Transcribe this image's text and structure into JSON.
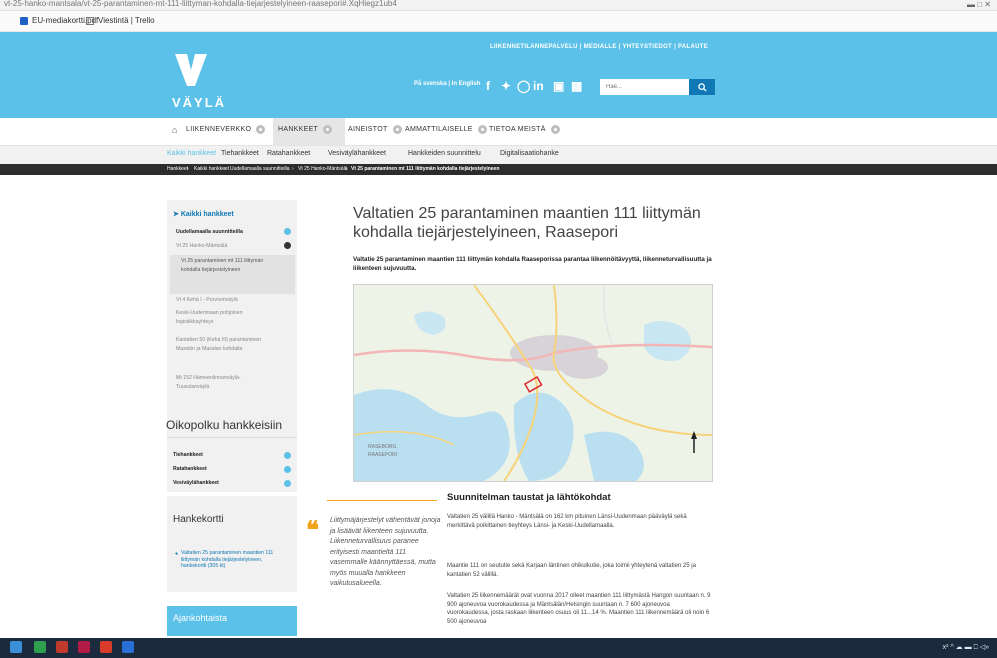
{
  "browser": {
    "url": "vt-25-hanko-mantsala/vt-25-parantaminen-mt-111-liittyman-kohdalla-tiejarjestelyineen-raasepori#.XqHiegz1ub4",
    "bookmarks": [
      {
        "label": "EU-mediakortti.pdf",
        "icon": "pdf-icon"
      },
      {
        "label": "Viestintä | Trello",
        "icon": "trello-icon"
      }
    ]
  },
  "header": {
    "top_links": "LIIKENNETILANNEPALVELU  |  MEDIALLE  |  YHTEYSTIEDOT  |  PALAUTE",
    "logo_text": "VÄYLÄ",
    "lang_sv": "På svenska",
    "lang_en": "In English",
    "search_placeholder": "Hae...",
    "colors": {
      "brand": "#5cc1e8",
      "button": "#0f78b5",
      "accent": "#f2a31a"
    }
  },
  "main_nav": [
    "LIIKENNEVERKKO",
    "HANKKEET",
    "AINEISTOT",
    "AMMATTILAISELLE",
    "TIETOA MEISTÄ"
  ],
  "sub_nav": [
    "Kaikki hankkeet",
    "Tiehankkeet",
    "Ratahankkeet",
    "Vesiväylähankkeet",
    "Hankkeiden suunnittelu",
    "Digitalisaatiohanke"
  ],
  "breadcrumb": [
    "Hankkeet",
    "Kaikki hankkeet",
    "Uudellamaalla suunnitteilla",
    "Vt 25 Hanko-Mäntsälä",
    "Vt 25 parantaminen mt 111 liittymän kohdalla tiejärjestelyineen"
  ],
  "sidebar": {
    "title": "Kaikki hankkeet",
    "section": "Uudellamaalla suunnitteilla",
    "sub": "Vt 25 Hanko-Mäntsälä",
    "selected": "Vt 25 parantaminen mt 111 liittymän kohdalla tiejärjestelyineen",
    "items": [
      "Vt 4 Kehä I - Porvoonväylä",
      "Keski-Uudenmaan pohjoinen logistiikkayhteys",
      "Kantatien 50 (Kehä III) parantaminen Maxxkin ja Masalan kohdalla",
      "Mt 152 Hämeenlinnanväylä-Tuusulanväylä"
    ],
    "shortcut_title": "Oikopolku hankkeisiin",
    "shortcuts": [
      "Tiehankkeet",
      "Ratahankkeet",
      "Vesiväylähankkeet"
    ],
    "card_title": "Hankekortti",
    "card_link": "Valtatien 25 parantaminen maantien 111 liittymän kohdalla tiejärjestelyineen, hankekortti (305 kt)",
    "news_title": "Ajankohtaista"
  },
  "content": {
    "title": "Valtatien 25 parantaminen maantien 111 liittymän kohdalla tiejärjestelyineen, Raasepori",
    "lead": "Valtatie 25 parantaminen maantien 111 liittymän kohdalla Raaseporissa parantaa liikennöitävyyttä, liikenneturvallisuutta ja liikenteen sujuvuutta.",
    "map_labels": [
      "RASEBORG",
      "RAASEPORI"
    ],
    "section_title": "Suunnitelman taustat ja lähtökohdat",
    "quote": "Liittymäjärjestelyt vähentävät jonoja ja lisäävät liikenteen sujuvuutta. Liikenneturvallisuus paranee erityisesti maantieltä 111 vasemmalle käännyttäessä, mutta myös muualla hankkeen vaikutusalueella.",
    "paragraphs": [
      "Valtatien 25 välillä Hanko - Mäntsälä on 162 km pituinen Länsi-Uudenmaan pääväylä sekä merkittävä poikittainen tieyhteys Länsi- ja Keski-Uudellamaalla.",
      "Maantie 111 on seututie sekä Karjaan läntinen ohikulkutie, joka toimii yhteytenä valtatien 25 ja kantatien 52 välillä.",
      "Valtatien 25 liikennemäärät ovat vuonna 2017 olleet maantien 111 liittymästä Hangon suuntaan n. 9 900 ajoneuvoa vuorokaudessa ja Mäntsälän/Helsingin suuntaan n. 7 600 ajoneuvoa vuorokaudessa, josta raskaan liikenteen osuus oli 11...14 %. Maantien 111 liikennemäärä oli noin 6 500 ajoneuvoa"
    ]
  },
  "taskbar": {
    "tray_text": "x²  ^  ☁ ▬ ⎕ ◁»"
  }
}
